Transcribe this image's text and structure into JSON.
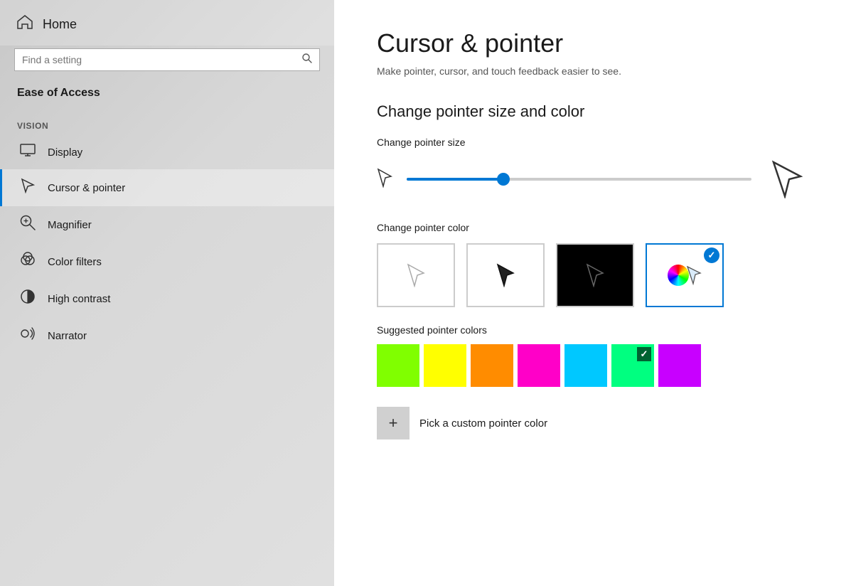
{
  "sidebar": {
    "home_label": "Home",
    "search_placeholder": "Find a setting",
    "ease_of_access_label": "Ease of Access",
    "vision_label": "Vision",
    "nav_items": [
      {
        "id": "display",
        "label": "Display",
        "icon": "display"
      },
      {
        "id": "cursor-pointer",
        "label": "Cursor & pointer",
        "icon": "cursor",
        "active": true
      },
      {
        "id": "magnifier",
        "label": "Magnifier",
        "icon": "magnifier"
      },
      {
        "id": "color-filters",
        "label": "Color filters",
        "icon": "color-filters"
      },
      {
        "id": "high-contrast",
        "label": "High contrast",
        "icon": "high-contrast"
      },
      {
        "id": "narrator",
        "label": "Narrator",
        "icon": "narrator"
      }
    ]
  },
  "main": {
    "page_title": "Cursor & pointer",
    "page_subtitle": "Make pointer, cursor, and touch feedback easier to see.",
    "section_title": "Change pointer size and color",
    "pointer_size_label": "Change pointer size",
    "slider_percent": 28,
    "pointer_color_label": "Change pointer color",
    "suggested_colors_label": "Suggested pointer colors",
    "color_options": [
      {
        "id": "white",
        "label": "White pointer",
        "bg": "#fff",
        "cursor_color": "#333"
      },
      {
        "id": "black-fill",
        "label": "Black pointer",
        "bg": "#fff",
        "cursor_color": "#222"
      },
      {
        "id": "black-bg",
        "label": "Black background pointer",
        "bg": "#000",
        "cursor_color": "#fff"
      },
      {
        "id": "custom",
        "label": "Custom pointer color",
        "bg": "custom",
        "selected": true
      }
    ],
    "suggested_colors": [
      {
        "id": "lime",
        "color": "#80ff00",
        "selected": false
      },
      {
        "id": "yellow",
        "color": "#ffff00",
        "selected": false
      },
      {
        "id": "orange",
        "color": "#ff8c00",
        "selected": false
      },
      {
        "id": "magenta",
        "color": "#ff00c8",
        "selected": false
      },
      {
        "id": "cyan",
        "color": "#00c8ff",
        "selected": false
      },
      {
        "id": "green",
        "color": "#00ff80",
        "selected": true
      },
      {
        "id": "purple",
        "color": "#c800ff",
        "selected": false
      }
    ],
    "custom_color_label": "Pick a custom pointer color",
    "custom_color_plus": "+"
  }
}
